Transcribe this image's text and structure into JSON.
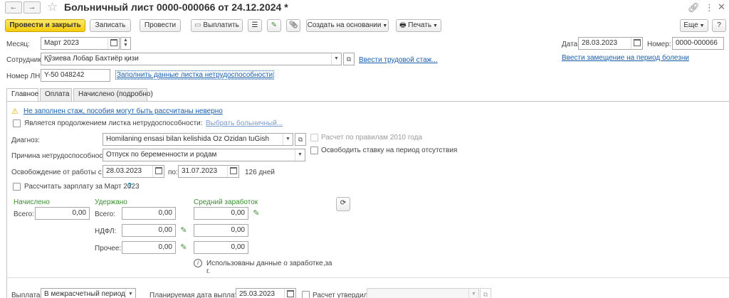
{
  "window": {
    "title": "Больничный лист 0000-000066 от 24.12.2024 *"
  },
  "toolbar": {
    "post_and_close": "Провести и закрыть",
    "save": "Записать",
    "post": "Провести",
    "pay": "Выплатить",
    "create_based_on": "Создать на основании",
    "print": "Печать",
    "more": "Еще"
  },
  "header": {
    "month_label": "Месяц:",
    "month_value": "Март 2023",
    "date_label": "Дата:",
    "date_value": "28.03.2023",
    "number_label": "Номер:",
    "number_value": "0000-000066",
    "employee_label": "Сотрудник:",
    "employee_value": "Қўзиева Лобар Бахтиёр қизи",
    "enter_seniority_link": "Ввести трудовой стаж...",
    "enter_replacement_link": "Ввести замещение на период болезни",
    "sick_number_label": "Номер ЛН:",
    "sick_number_value": "Y-50 048242",
    "fill_data_link": "Заполнить данные листка нетрудоспособности"
  },
  "tabs": [
    {
      "label": "Главное",
      "active": true
    },
    {
      "label": "Оплата",
      "active": false
    },
    {
      "label": "Начислено (подробно)",
      "active": false
    }
  ],
  "main": {
    "warning_text": "Не заполнен стаж, пособия могут быть рассчитаны неверно",
    "continuation_label": "Является продолжением листка нетрудоспособности:",
    "choose_sick_link": "Выбрать больничный...",
    "diagnosis_label": "Диагноз:",
    "diagnosis_value": "Homilaning ensasi bilan kelishida Oz Ozidan tuGish",
    "rules_2010_label": "Расчет по правилам 2010 года",
    "reason_label": "Причина нетрудоспособности:",
    "reason_value": "Отпуск по беременности и родам",
    "free_rate_label": "Освободить ставку на период отсутствия",
    "release_label": "Освобождение от работы с:",
    "release_from": "28.03.2023",
    "to_label": "по:",
    "release_to": "31.07.2023",
    "days_text": "126 дней",
    "calc_salary_label": "Рассчитать зарплату за Март 2023",
    "help_mark": "?",
    "accrued_header": "Начислено",
    "withheld_header": "Удержано",
    "avg_header": "Средний заработок",
    "total_label_1": "Всего:",
    "accrued_total": "0,00",
    "total_label_2": "Всего:",
    "withheld_total": "0,00",
    "ndfl_label": "НДФЛ:",
    "ndfl_value": "0,00",
    "other_label": "Прочее:",
    "other_value": "0,00",
    "avg_value_1": "0,00",
    "avg_value_2": "0,00",
    "avg_value_3": "0,00",
    "info_line1": "Использованы данные о заработке за",
    "info_line1_tail": ",",
    "info_line2": "г."
  },
  "footer": {
    "payout_label": "Выплата:",
    "payout_value": "В межрасчетный период",
    "planned_date_label": "Планируемая дата выплаты:",
    "planned_date_value": "25.03.2023",
    "calc_approved_label": "Расчет утвердил"
  }
}
